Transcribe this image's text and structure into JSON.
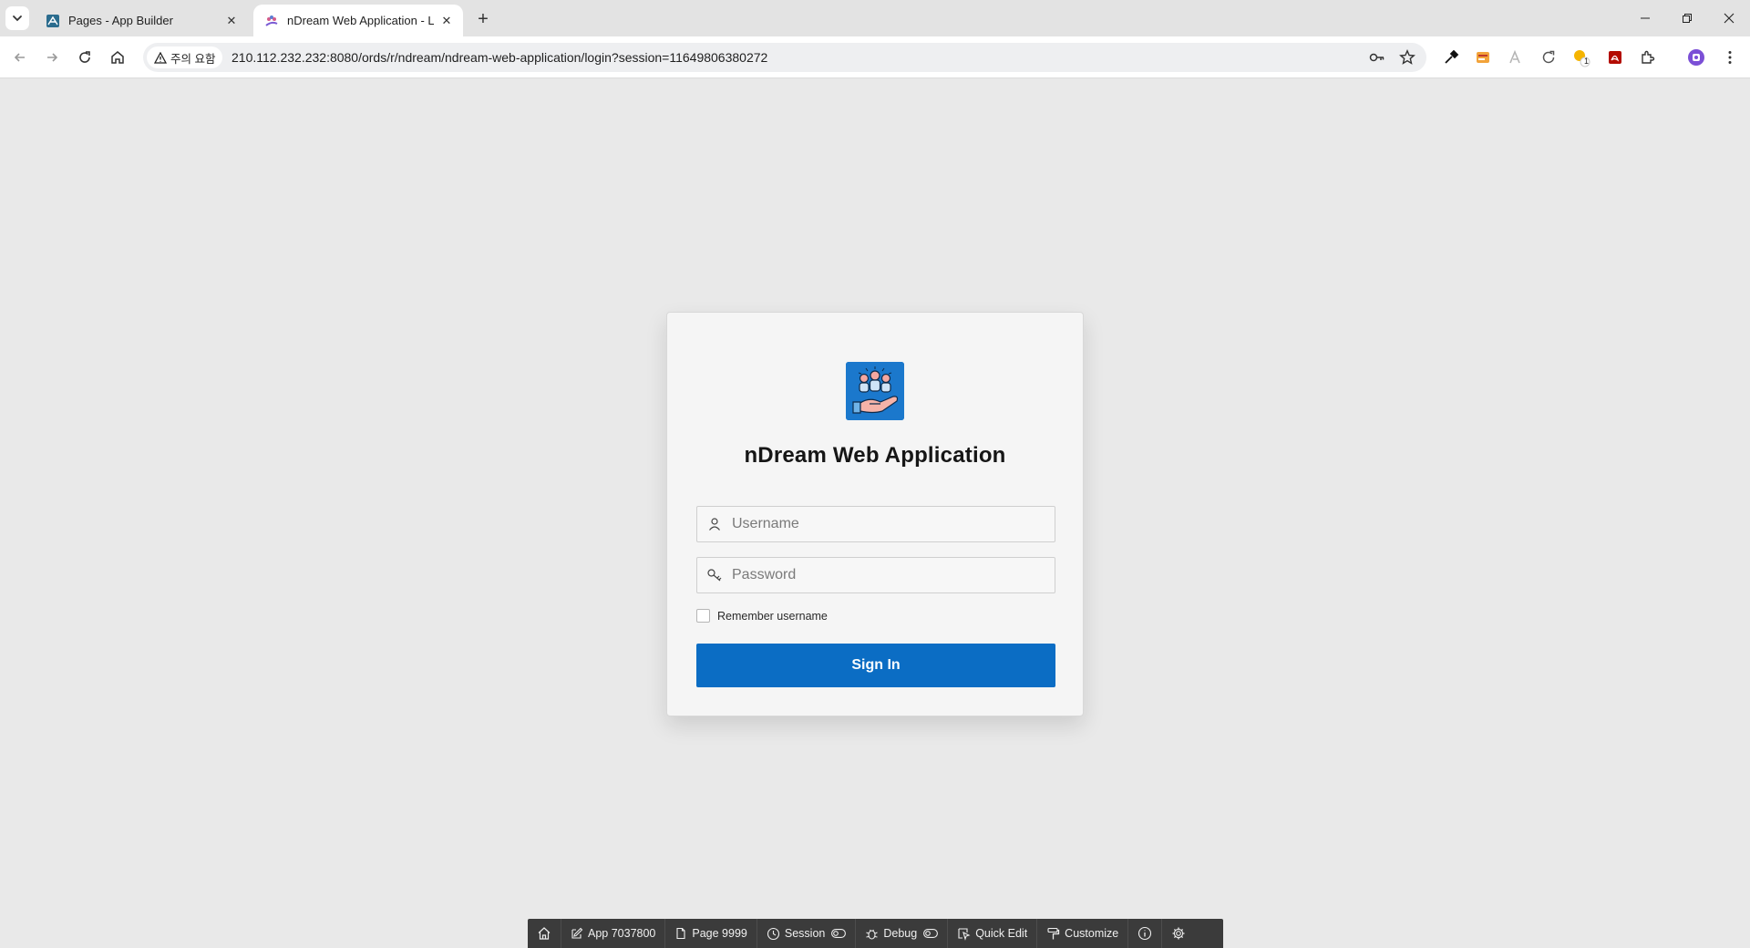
{
  "browser": {
    "tabs": [
      {
        "title": "Pages - App Builder",
        "active": false
      },
      {
        "title": "nDream Web Application - Log",
        "active": true
      }
    ],
    "address": {
      "security_chip": "주의 요함",
      "url": "210.112.232.232:8080/ords/r/ndream/ndream-web-application/login?session=11649806380272"
    },
    "extension_badge": "1"
  },
  "login": {
    "app_name": "nDream Web Application",
    "username_placeholder": "Username",
    "password_placeholder": "Password",
    "remember_label": "Remember username",
    "sign_in_label": "Sign In"
  },
  "dev_toolbar": {
    "app": "App 7037800",
    "page": "Page 9999",
    "session": "Session",
    "debug": "Debug",
    "quick_edit": "Quick Edit",
    "customize": "Customize"
  },
  "colors": {
    "primary_button": "#0b6dc4",
    "page_background": "#e9e9e9",
    "dev_toolbar": "#3b3b3b"
  }
}
